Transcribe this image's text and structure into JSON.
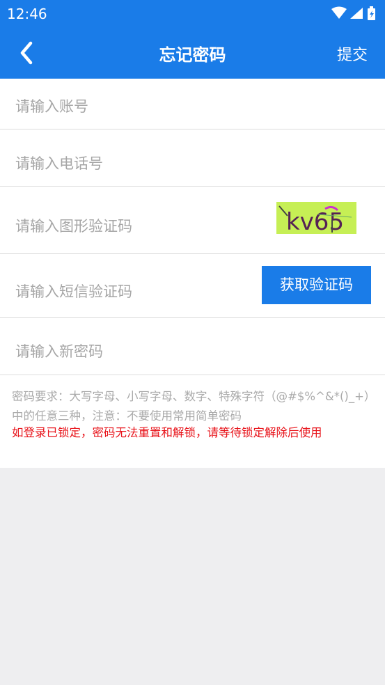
{
  "status_bar": {
    "time": "12:46",
    "icons": [
      "wifi-icon",
      "signal-icon",
      "battery-icon"
    ]
  },
  "app_bar": {
    "title": "忘记密码",
    "back_icon": "chevron-left-icon",
    "submit_label": "提交"
  },
  "form": {
    "account_placeholder": "请输入账号",
    "phone_placeholder": "请输入电话号",
    "captcha_placeholder": "请输入图形验证码",
    "captcha_text": "kv65",
    "sms_placeholder": "请输入短信验证码",
    "sms_button_label": "获取验证码",
    "new_password_placeholder": "请输入新密码"
  },
  "hint": "密码要求：大写字母、小写字母、数字、特殊字符（@#$%^&*()_+）中的任意三种，注意：不要使用常用简单密码",
  "warning": "如登录已锁定，密码无法重置和解锁，请等待锁定解除后使用",
  "colors": {
    "primary": "#1a7ce8",
    "warning": "#e8141b",
    "captcha_bg": "#c6ef55"
  }
}
